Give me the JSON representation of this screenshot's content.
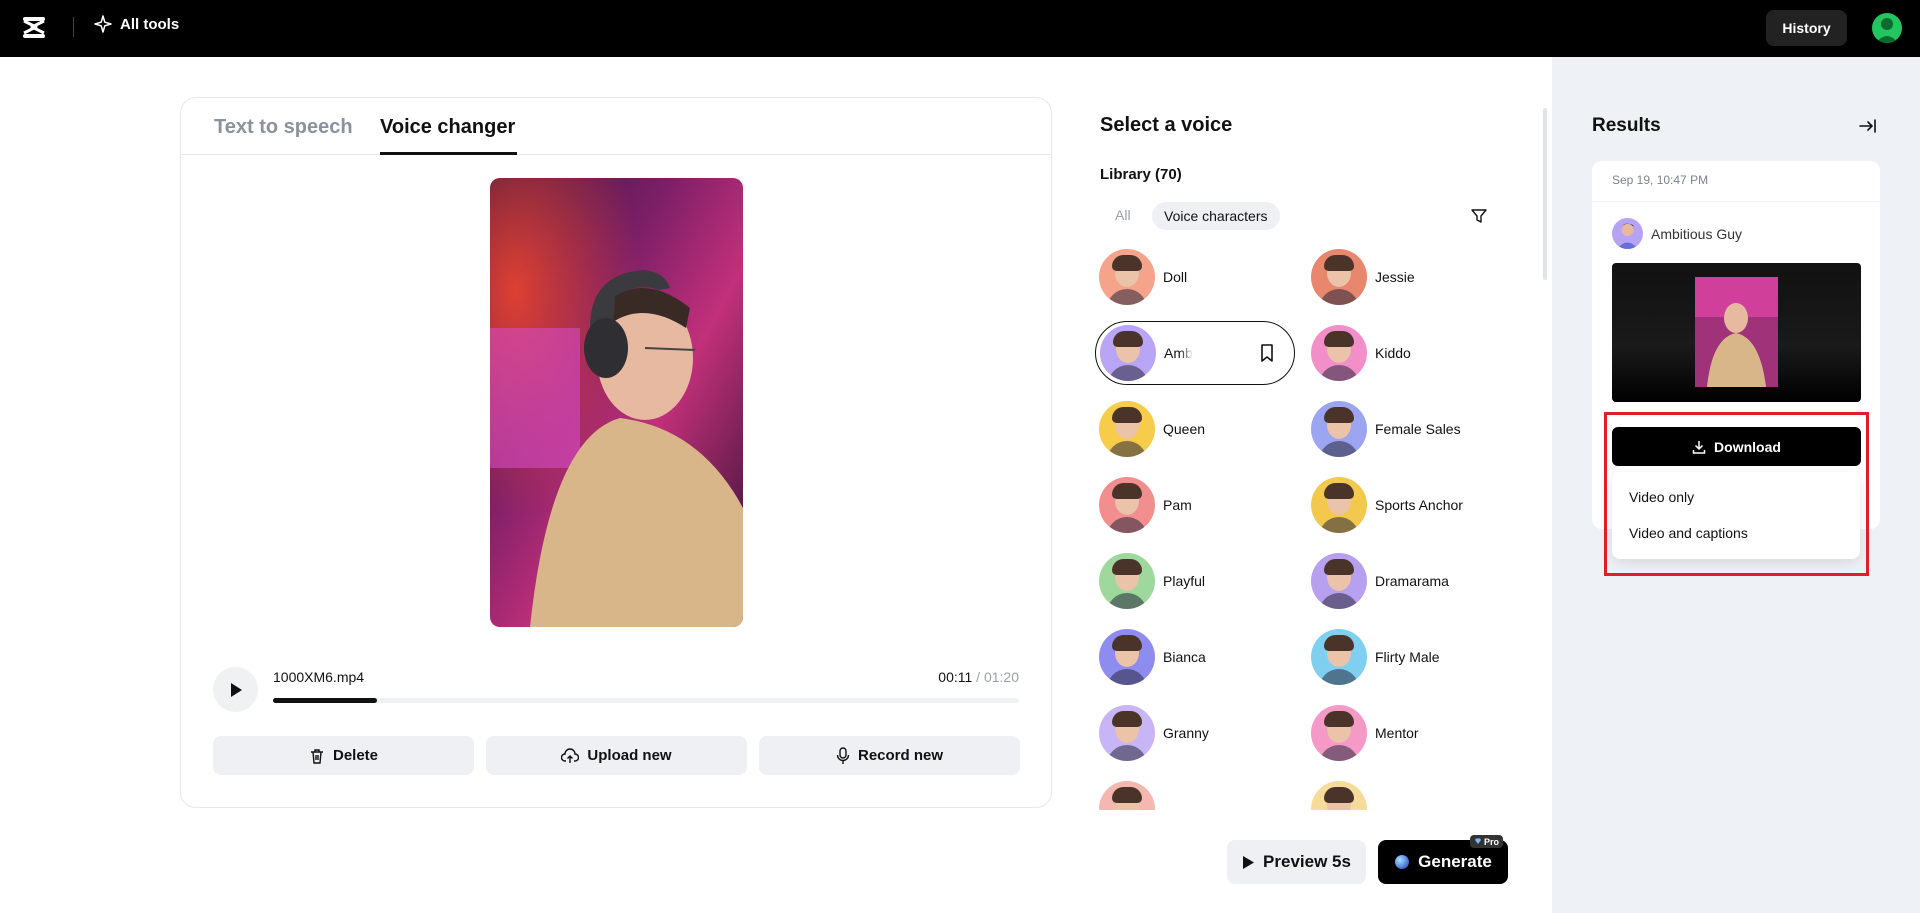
{
  "topbar": {
    "all_tools_label": "All tools",
    "history_label": "History"
  },
  "tabs": {
    "text_to_speech": "Text to speech",
    "voice_changer": "Voice changer",
    "active": "voice_changer"
  },
  "player": {
    "filename": "1000XM6.mp4",
    "current_time": "00:11",
    "separator": " / ",
    "total_time": "01:20",
    "progress": 0.14
  },
  "actions": {
    "delete_label": "Delete",
    "upload_label": "Upload new",
    "record_label": "Record new"
  },
  "voice_panel": {
    "title": "Select a voice",
    "library_label": "Library (70)",
    "filter_all": "All",
    "filter_active": "Voice characters",
    "voices": [
      {
        "name": "Doll",
        "bg": "#f5a38a"
      },
      {
        "name": "Jessie",
        "bg": "#e8866e"
      },
      {
        "name": "Amb",
        "bg": "#b9a5f5",
        "selected": true
      },
      {
        "name": "Kiddo",
        "bg": "#f28ec8"
      },
      {
        "name": "Queen",
        "bg": "#f6cc4a"
      },
      {
        "name": "Female Sales",
        "bg": "#9ca5f2"
      },
      {
        "name": "Pam",
        "bg": "#f28e8e"
      },
      {
        "name": "Sports Anchor",
        "bg": "#f2c94c"
      },
      {
        "name": "Playful",
        "bg": "#9ed89c"
      },
      {
        "name": "Dramarama",
        "bg": "#b8a0f0"
      },
      {
        "name": "Bianca",
        "bg": "#8f8cf0"
      },
      {
        "name": "Flirty Male",
        "bg": "#7fd0f0"
      },
      {
        "name": "Granny",
        "bg": "#c7b5f5"
      },
      {
        "name": "Mentor",
        "bg": "#f59ac7"
      },
      {
        "name": "",
        "bg": "#f5b8b0"
      },
      {
        "name": "",
        "bg": "#f5dc9a"
      }
    ]
  },
  "bottom_actions": {
    "preview_label": "Preview 5s",
    "generate_label": "Generate",
    "pro_label": "Pro"
  },
  "results": {
    "title": "Results",
    "date": "Sep 19, 10:47 PM",
    "voice_name": "Ambitious Guy",
    "download_label": "Download",
    "options": [
      "Video only",
      "Video and captions"
    ]
  },
  "colors": {
    "highlight": "#e11d2a",
    "accent": "#000000"
  }
}
